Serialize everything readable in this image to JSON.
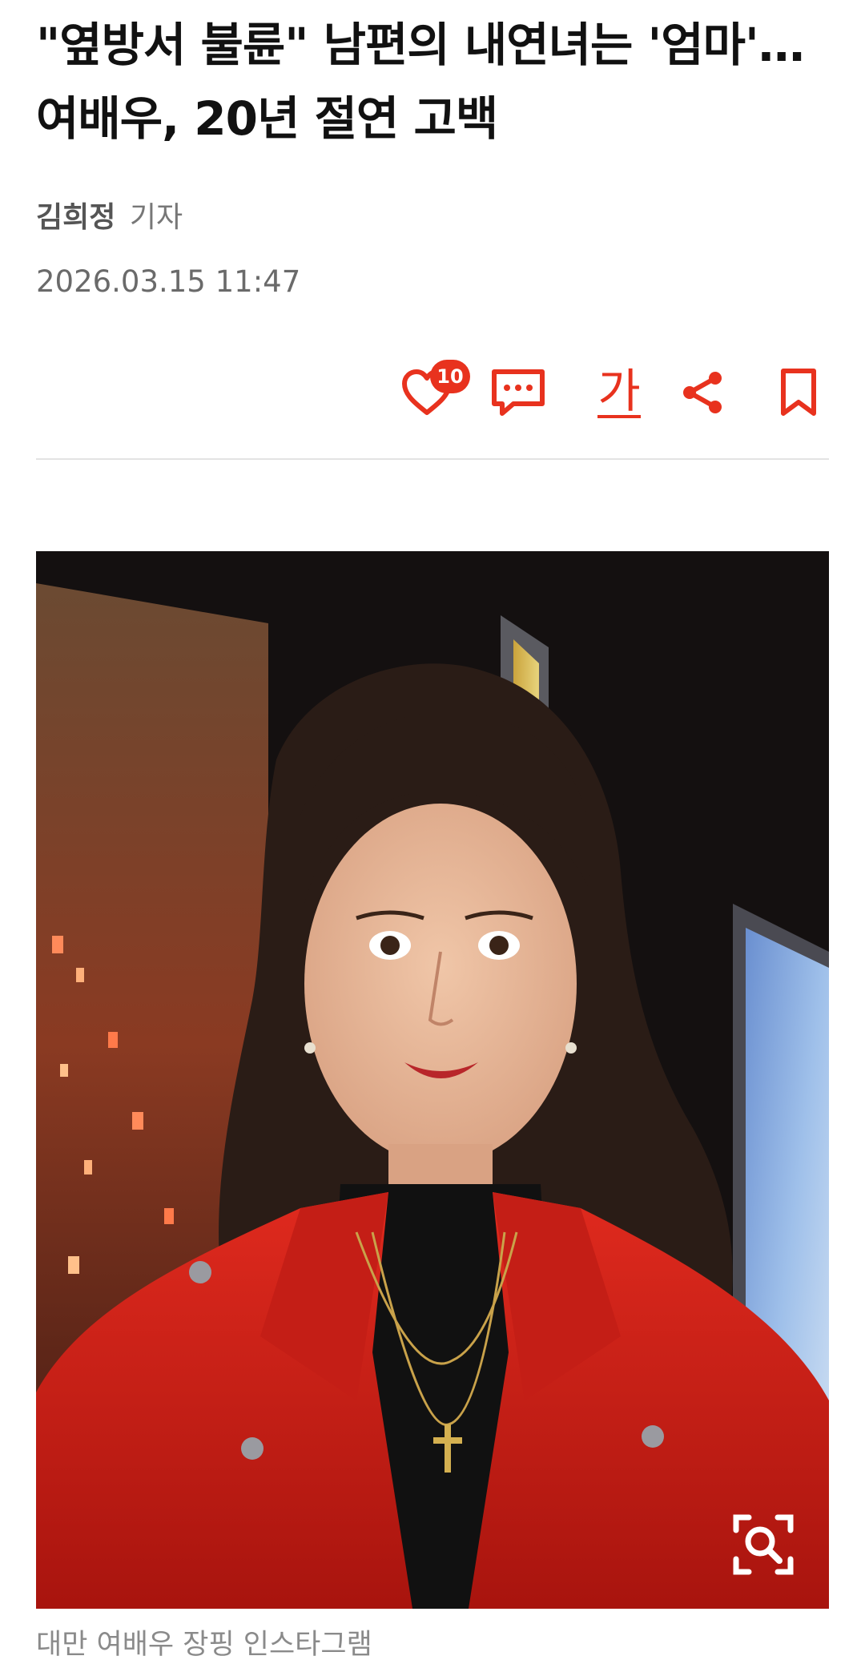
{
  "article": {
    "headline": "\"옆방서 불륜\" 남편의 내연녀는 '엄마'…여배우, 20년 절연 고백",
    "author": "김희정",
    "author_role": "기자",
    "timestamp": "2026.03.15 11:47"
  },
  "toolbar": {
    "like_count": "10",
    "font_size_label": "가",
    "accent_color": "#e8321e"
  },
  "icons": [
    "heart-icon",
    "comment-icon",
    "font-size-icon",
    "share-icon",
    "bookmark-icon",
    "zoom-icon"
  ],
  "photo": {
    "caption": "대만 여배우 장핑 인스타그램"
  }
}
